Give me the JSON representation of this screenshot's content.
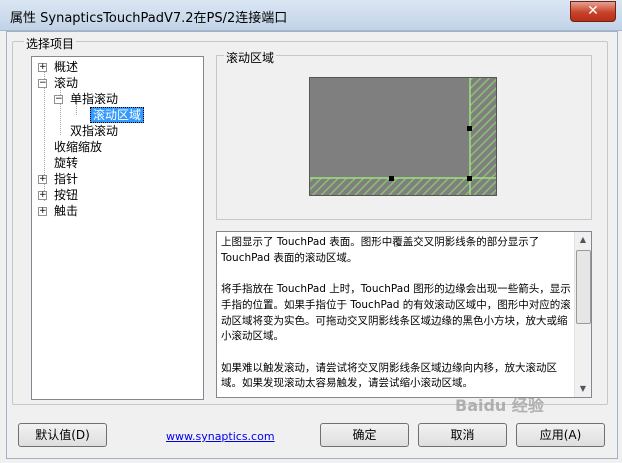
{
  "window": {
    "title": "属性 SynapticsTouchPadV7.2在PS/2连接端口",
    "close_symbol": "✕"
  },
  "group": {
    "label": "选择项目"
  },
  "tree": {
    "items": [
      {
        "label": "概述",
        "expander": "+"
      },
      {
        "label": "滚动",
        "expander": "−"
      },
      {
        "label": "单指滚动",
        "expander": "−"
      },
      {
        "label": "滚动区域",
        "selected": true
      },
      {
        "label": "双指滚动"
      },
      {
        "label": "收缩缩放"
      },
      {
        "label": "旋转"
      },
      {
        "label": "指针",
        "expander": "+"
      },
      {
        "label": "按钮",
        "expander": "+"
      },
      {
        "label": "触击",
        "expander": "+"
      }
    ]
  },
  "panel": {
    "label": "滚动区域"
  },
  "description": {
    "text": "上图显示了 TouchPad 表面。图形中覆盖交叉阴影线条的部分显示了 TouchPad 表面的滚动区域。\n\n将手指放在 TouchPad 上时，TouchPad 图形的边缘会出现一些箭头，显示手指的位置。如果手指位于 TouchPad 的有效滚动区域中，图形中对应的滚动区域将变为实色。可拖动交叉阴影线条区域边缘的黑色小方块，放大或缩小滚动区域。\n\n如果难以触发滚动，请尝试将交叉阴影线条区域边缘向内移，放大滚动区域。如果发现滚动太容易触发，请尝试缩小滚动区域。"
  },
  "buttons": {
    "defaults": "默认值(D)",
    "ok": "确定",
    "cancel": "取消",
    "apply": "应用(A)"
  },
  "link": {
    "text": "www.synaptics.com"
  },
  "watermark": {
    "text": "Baidu 经验"
  },
  "colors": {
    "hatch": "#8bbf72",
    "pad": "#7f7f7f",
    "selection": "#3399ff",
    "link": "#0000ee"
  }
}
